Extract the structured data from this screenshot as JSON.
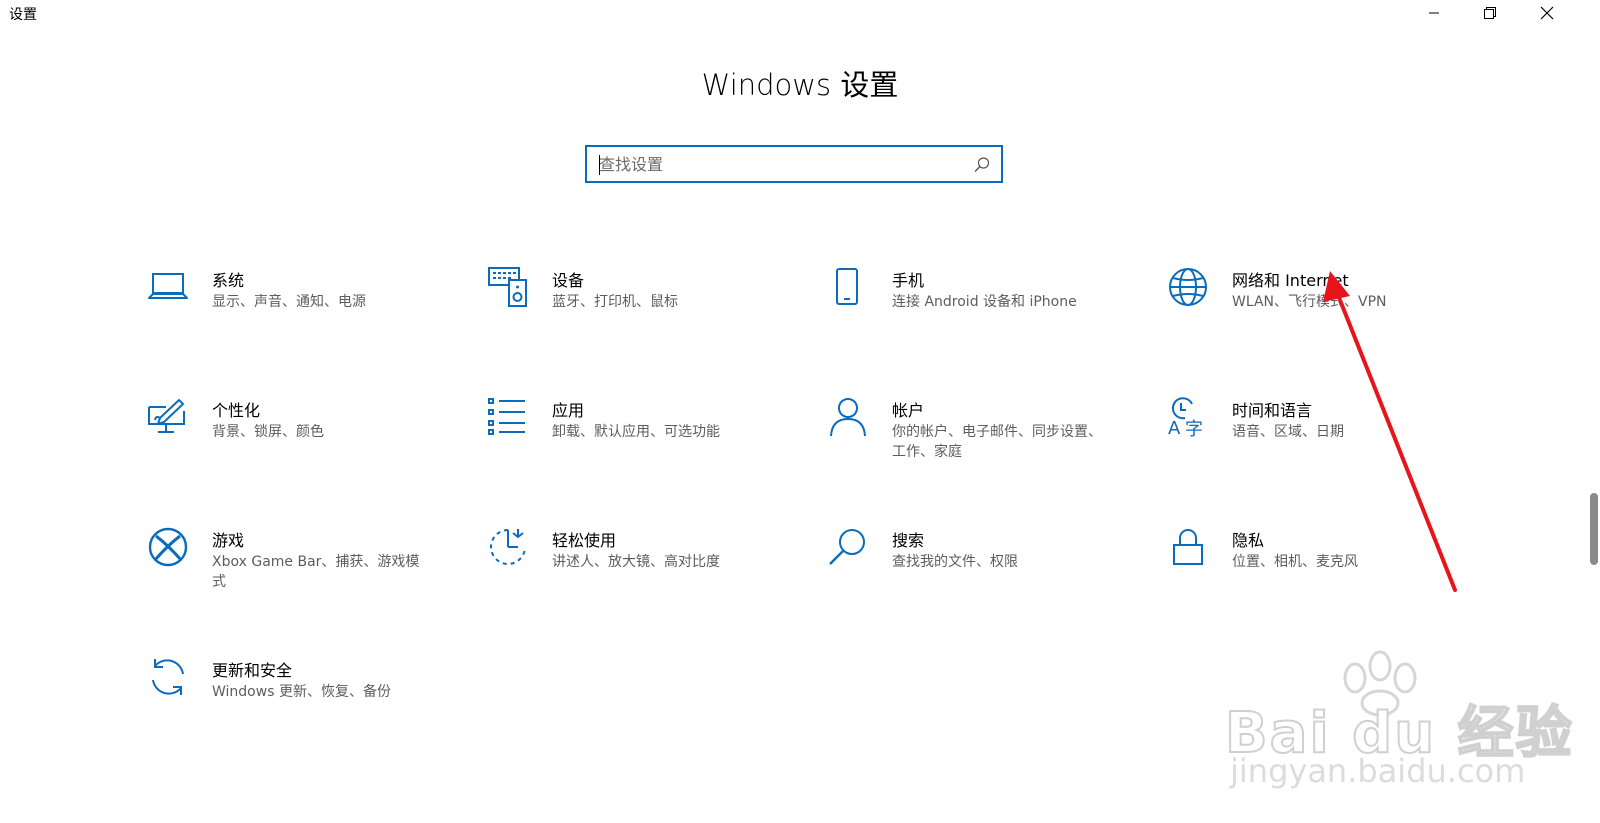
{
  "window": {
    "title": "设置",
    "controls": {
      "minimize": "minimize-icon",
      "restore": "restore-icon",
      "close": "close-icon"
    }
  },
  "page": {
    "title": "Windows 设置"
  },
  "search": {
    "placeholder": "查找设置",
    "value": ""
  },
  "tiles": [
    {
      "id": "system",
      "icon": "laptop-icon",
      "title": "系统",
      "desc": "显示、声音、通知、电源"
    },
    {
      "id": "devices",
      "icon": "devices-icon",
      "title": "设备",
      "desc": "蓝牙、打印机、鼠标"
    },
    {
      "id": "phone",
      "icon": "phone-icon",
      "title": "手机",
      "desc": "连接 Android 设备和 iPhone"
    },
    {
      "id": "network",
      "icon": "globe-icon",
      "title": "网络和 Internet",
      "desc": "WLAN、飞行模式、VPN"
    },
    {
      "id": "personalization",
      "icon": "personalization-icon",
      "title": "个性化",
      "desc": "背景、锁屏、颜色"
    },
    {
      "id": "apps",
      "icon": "apps-list-icon",
      "title": "应用",
      "desc": "卸载、默认应用、可选功能"
    },
    {
      "id": "accounts",
      "icon": "person-icon",
      "title": "帐户",
      "desc": "你的帐户、电子邮件、同步设置、工作、家庭"
    },
    {
      "id": "time-language",
      "icon": "time-language-icon",
      "title": "时间和语言",
      "desc": "语音、区域、日期"
    },
    {
      "id": "gaming",
      "icon": "xbox-icon",
      "title": "游戏",
      "desc": "Xbox Game Bar、捕获、游戏模式"
    },
    {
      "id": "ease-of-access",
      "icon": "ease-of-access-icon",
      "title": "轻松使用",
      "desc": "讲述人、放大镜、高对比度"
    },
    {
      "id": "search",
      "icon": "search-magnifier-icon",
      "title": "搜索",
      "desc": "查找我的文件、权限"
    },
    {
      "id": "privacy",
      "icon": "lock-icon",
      "title": "隐私",
      "desc": "位置、相机、麦克风"
    },
    {
      "id": "update-security",
      "icon": "sync-icon",
      "title": "更新和安全",
      "desc": "Windows 更新、恢复、备份"
    }
  ],
  "watermark": {
    "brand": "Bai du 经验",
    "url": "jingyan.baidu.com"
  },
  "colors": {
    "accent": "#0b6cbd",
    "annotation": "#e8141b"
  }
}
